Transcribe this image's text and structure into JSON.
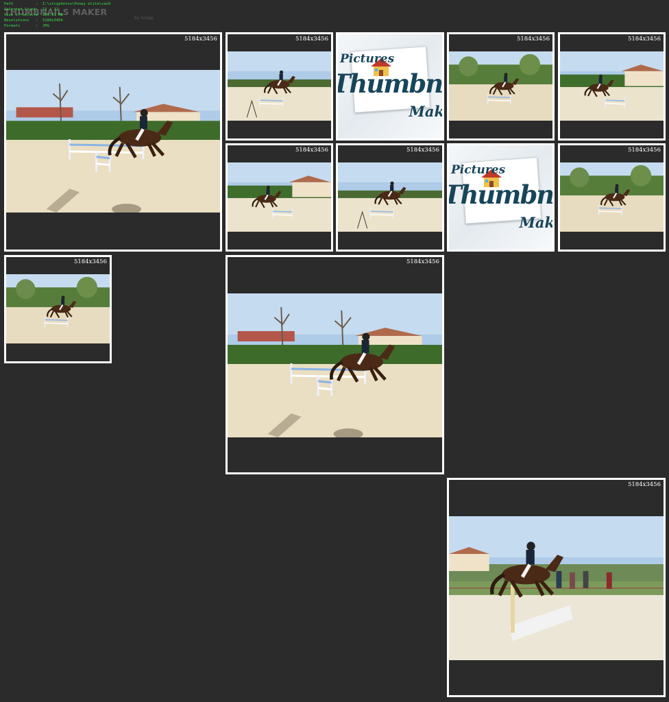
{
  "header": {
    "info": [
      {
        "label": "Path",
        "value": "I:\\stcyphotos\\Poney  elite\\cav9"
      },
      {
        "label": "Selected Count",
        "value": "12 / 12"
      },
      {
        "label": "Size of Selecte",
        "value": "105.61 MB"
      },
      {
        "label": "Resolutions",
        "value": "5184x3456"
      },
      {
        "label": "Formats",
        "value": "JPG"
      }
    ],
    "separator": ":",
    "brand_title": "THUMBNAILS MAKER",
    "brand_sub": "by Scoop"
  },
  "logo": {
    "line1": "Pictures",
    "line2": "Thumbnails",
    "line3": "Mak",
    "icon": "house-icon"
  },
  "thumbnails": [
    {
      "id": "t1",
      "type": "photo",
      "resolution": "5184x3456"
    },
    {
      "id": "t2",
      "type": "photo",
      "resolution": "5184x3456"
    },
    {
      "id": "t3",
      "type": "logo"
    },
    {
      "id": "t4",
      "type": "photo",
      "resolution": "5184x3456"
    },
    {
      "id": "t5",
      "type": "photo",
      "resolution": "5184x3456"
    },
    {
      "id": "t6",
      "type": "photo",
      "resolution": "5184x3456"
    },
    {
      "id": "t7",
      "type": "photo",
      "resolution": "5184x3456"
    },
    {
      "id": "t8",
      "type": "logo"
    },
    {
      "id": "t9",
      "type": "photo",
      "resolution": "5184x3456"
    },
    {
      "id": "t10",
      "type": "photo",
      "resolution": "5184x3456"
    },
    {
      "id": "t11",
      "type": "photo",
      "resolution": "5184x3456"
    },
    {
      "id": "t12",
      "type": "photo",
      "resolution": "5184x3456"
    }
  ],
  "colors": {
    "background": "#2b2b2b",
    "tile_border": "#ffffff",
    "info_text": "#3be04a",
    "brand": "#5f5f5f",
    "logo_text": "#17455a"
  }
}
